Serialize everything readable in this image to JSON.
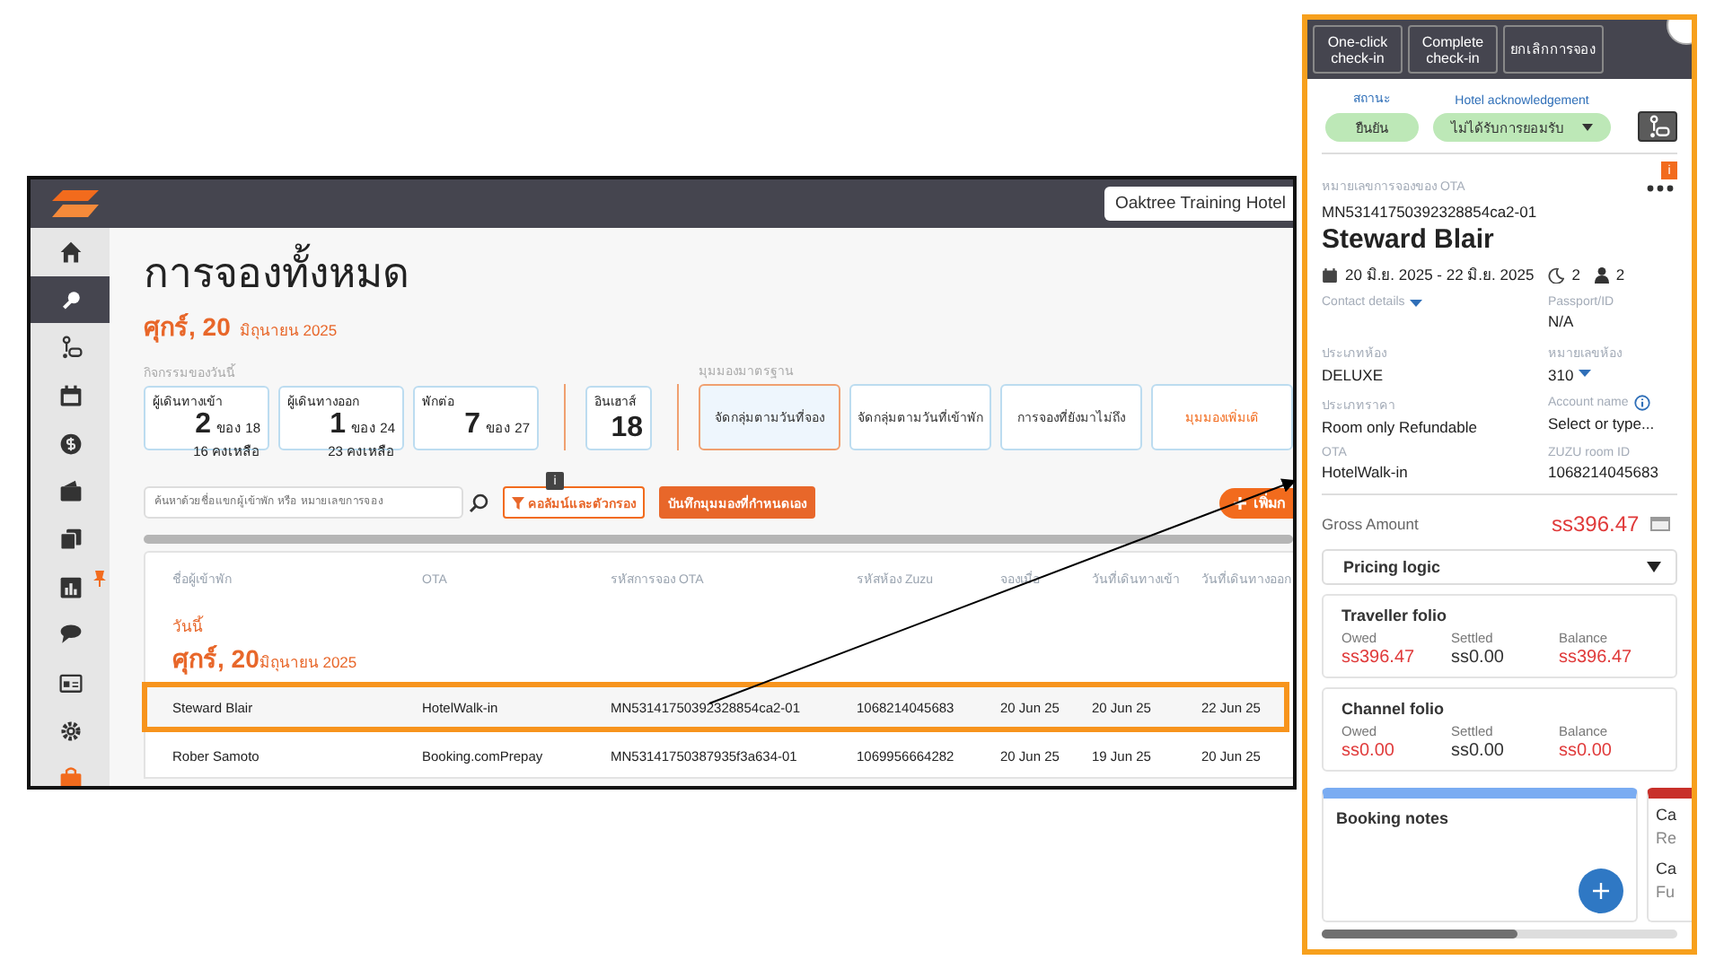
{
  "app": {
    "hotel": "Oaktree Training Hotel",
    "sidebar": [
      {
        "selected": false
      },
      {
        "selected": true
      },
      {
        "selected": false
      },
      {
        "selected": false
      },
      {
        "selected": false
      },
      {
        "selected": false
      },
      {
        "selected": false
      },
      {
        "selected": false
      },
      {
        "selected": false
      },
      {
        "selected": false
      },
      {
        "selected": false
      },
      {
        "selected": false
      }
    ]
  },
  "page": {
    "title": "การจองทั้งหมด",
    "date_day": "ศุกร์, 20",
    "date_rest": "มิถุนายน 2025"
  },
  "today_activity": {
    "label": "กิจกรรมของวันนี้",
    "cards": [
      {
        "title": "ผู้เดินทางเข้า",
        "value": "2",
        "of": "ของ 18",
        "remaining": "16 คงเหลือ"
      },
      {
        "title": "ผู้เดินทางออก",
        "value": "1",
        "of": "ของ 24",
        "remaining": "23 คงเหลือ"
      },
      {
        "title": "พักต่อ",
        "value": "7",
        "of": "ของ 27"
      }
    ]
  },
  "in_house": {
    "title": "อินเฮาส์",
    "value": "18"
  },
  "views": {
    "label": "มุมมองมาตรฐาน",
    "items": [
      {
        "label": "จัดกลุ่มตามวันที่จอง",
        "selected": true,
        "kind": "view"
      },
      {
        "label": "จัดกลุ่มตามวันที่เข้าพัก",
        "selected": false,
        "kind": "view"
      },
      {
        "label": "การจองที่ยังมาไม่ถึง",
        "selected": false,
        "kind": "view"
      },
      {
        "label": "มุมมองเพิ่มเติ",
        "selected": false,
        "kind": "more"
      }
    ]
  },
  "info_badge": "i",
  "search": {
    "placeholder": "ค้นหาด้วยชื่อแขกผู้เข้าพัก หรือ หมายเลขการจอง"
  },
  "filter_button": "คอลัมน์และตัวกรอง",
  "save_view_button": "บันทึกมุมมองที่กำหนดเอง",
  "add_button": "เพิ่มก",
  "table": {
    "columns": [
      "ชื่อผู้เข้าพัก",
      "OTA",
      "รหัสการจอง OTA",
      "รหัสห้อง Zuzu",
      "จองเมื่อ",
      "วันที่เดินทางเข้า",
      "วันที่เดินทางออก"
    ],
    "group": {
      "label": "วันนี้",
      "day": "ศุกร์, 20",
      "rest": "มิถุนายน 2025"
    },
    "rows": [
      {
        "selected": true,
        "cells": [
          "Steward Blair",
          "HotelWalk-in",
          "MN53141750392328854ca2-01",
          "1068214045683",
          "20 Jun 25",
          "20 Jun 25",
          "22 Jun 25"
        ]
      },
      {
        "selected": false,
        "cells": [
          "Rober Samoto",
          "Booking.comPrepay",
          "MN53141750387935f3a634-01",
          "1069956664282",
          "20 Jun 25",
          "19 Jun 25",
          "20 Jun 25"
        ]
      }
    ]
  },
  "booking_panel": {
    "actions": [
      "One-click check-in",
      "Complete check-in",
      "ยกเลิกการจอง"
    ],
    "status": {
      "label": "สถานะ",
      "value": "ยืนยัน"
    },
    "acknowledgement": {
      "label": "Hotel acknowledgement",
      "value": "ไม่ได้รับการยอมรับ"
    },
    "ota_number": {
      "label": "หมายเลขการจองของ OTA",
      "value": "MN53141750392328854ca2-01"
    },
    "alert_badge": "i",
    "guest": "Steward Blair",
    "dates": "20 มิ.ย. 2025 - 22 มิ.ย. 2025",
    "nights": "2",
    "guests": "2",
    "fields": [
      {
        "label": "Contact details",
        "kind": "toggle"
      },
      {
        "label": "Passport/ID",
        "value": "N/A",
        "kind": "plain"
      },
      {
        "label": "ประเภทห้อง",
        "value": "DELUXE",
        "kind": "plain"
      },
      {
        "label": "หมายเลขห้อง",
        "value": "310",
        "kind": "select"
      },
      {
        "label": "ประเภทราคา",
        "value": "Room only Refundable",
        "kind": "plain"
      },
      {
        "label": "Account name",
        "value": "Select or type...",
        "kind": "info"
      },
      {
        "label": "OTA",
        "value": "HotelWalk-in",
        "kind": "plain"
      },
      {
        "label": "ZUZU room ID",
        "value": "1068214045683",
        "kind": "plain"
      }
    ],
    "gross": {
      "label": "Gross Amount",
      "value": "ss396.47"
    },
    "pricing_logic": "Pricing logic",
    "folios": [
      {
        "title": "Traveller folio",
        "amounts": [
          {
            "label": "Owed",
            "value": "ss396.47",
            "alert": true
          },
          {
            "label": "Settled",
            "value": "ss0.00",
            "alert": false
          },
          {
            "label": "Balance",
            "value": "ss396.47",
            "alert": true
          }
        ]
      },
      {
        "title": "Channel folio",
        "amounts": [
          {
            "label": "Owed",
            "value": "ss0.00",
            "alert": true
          },
          {
            "label": "Settled",
            "value": "ss0.00",
            "alert": false
          },
          {
            "label": "Balance",
            "value": "ss0.00",
            "alert": true
          }
        ]
      }
    ],
    "notes": {
      "title": "Booking notes"
    },
    "next_card": {
      "lines": [
        "Ca",
        "Re",
        "Ca",
        "Fu"
      ]
    }
  }
}
